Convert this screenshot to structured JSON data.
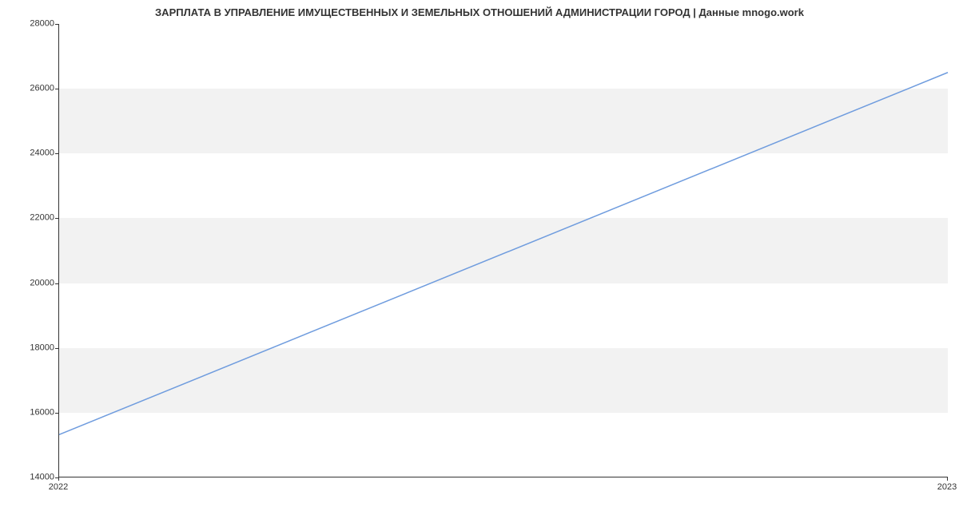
{
  "chart_data": {
    "type": "line",
    "title": "ЗАРПЛАТА В УПРАВЛЕНИЕ ИМУЩЕСТВЕННЫХ И ЗЕМЕЛЬНЫХ ОТНОШЕНИЙ АДМИНИСТРАЦИИ ГОРОД | Данные mnogo.work",
    "x": [
      "2022",
      "2023"
    ],
    "values": [
      15300,
      26500
    ],
    "xlabel": "",
    "ylabel": "",
    "ylim": [
      14000,
      28000
    ],
    "yticks": [
      14000,
      16000,
      18000,
      20000,
      22000,
      24000,
      26000,
      28000
    ],
    "xticks": [
      "2022",
      "2023"
    ],
    "grid": true,
    "line_color": "#6f9cde"
  }
}
